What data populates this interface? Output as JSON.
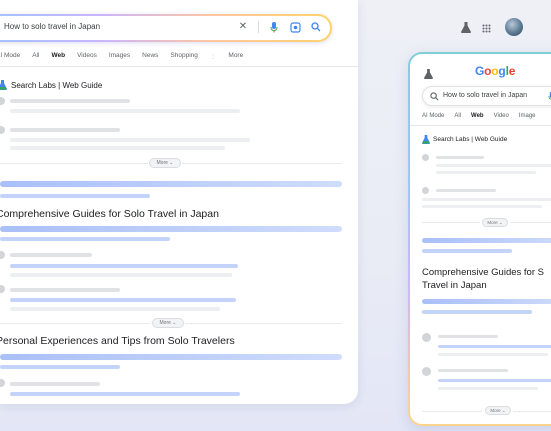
{
  "desktop": {
    "search_query": "How to solo travel in Japan",
    "tabs": [
      "AI Mode",
      "All",
      "Web",
      "Videos",
      "Images",
      "News",
      "Shopping",
      "More"
    ],
    "active_tab": "Web",
    "section_title": "Search Labs | Web Guide",
    "more_label": "More",
    "heading1": "Comprehensive Guides for Solo Travel in Japan",
    "heading2": "Personal Experiences and Tips from Solo Travelers"
  },
  "mobile": {
    "logo": "Google",
    "search_query": "How to solo travel in Japan",
    "tabs": [
      "AI Mode",
      "All",
      "Web",
      "Video",
      "Image"
    ],
    "active_tab": "Web",
    "section_title": "Search Labs | Web Guide",
    "more_label": "More",
    "heading_line1": "Comprehensive Guides for S",
    "heading_line2": "Travel in Japan"
  },
  "colors": {
    "accent_blue": "#4285f4",
    "bar_blue": "#a9bff8"
  },
  "icons": [
    "close-icon",
    "mic-icon",
    "lens-icon",
    "search-icon",
    "labs-flask-icon",
    "apps-grid-icon",
    "avatar"
  ]
}
